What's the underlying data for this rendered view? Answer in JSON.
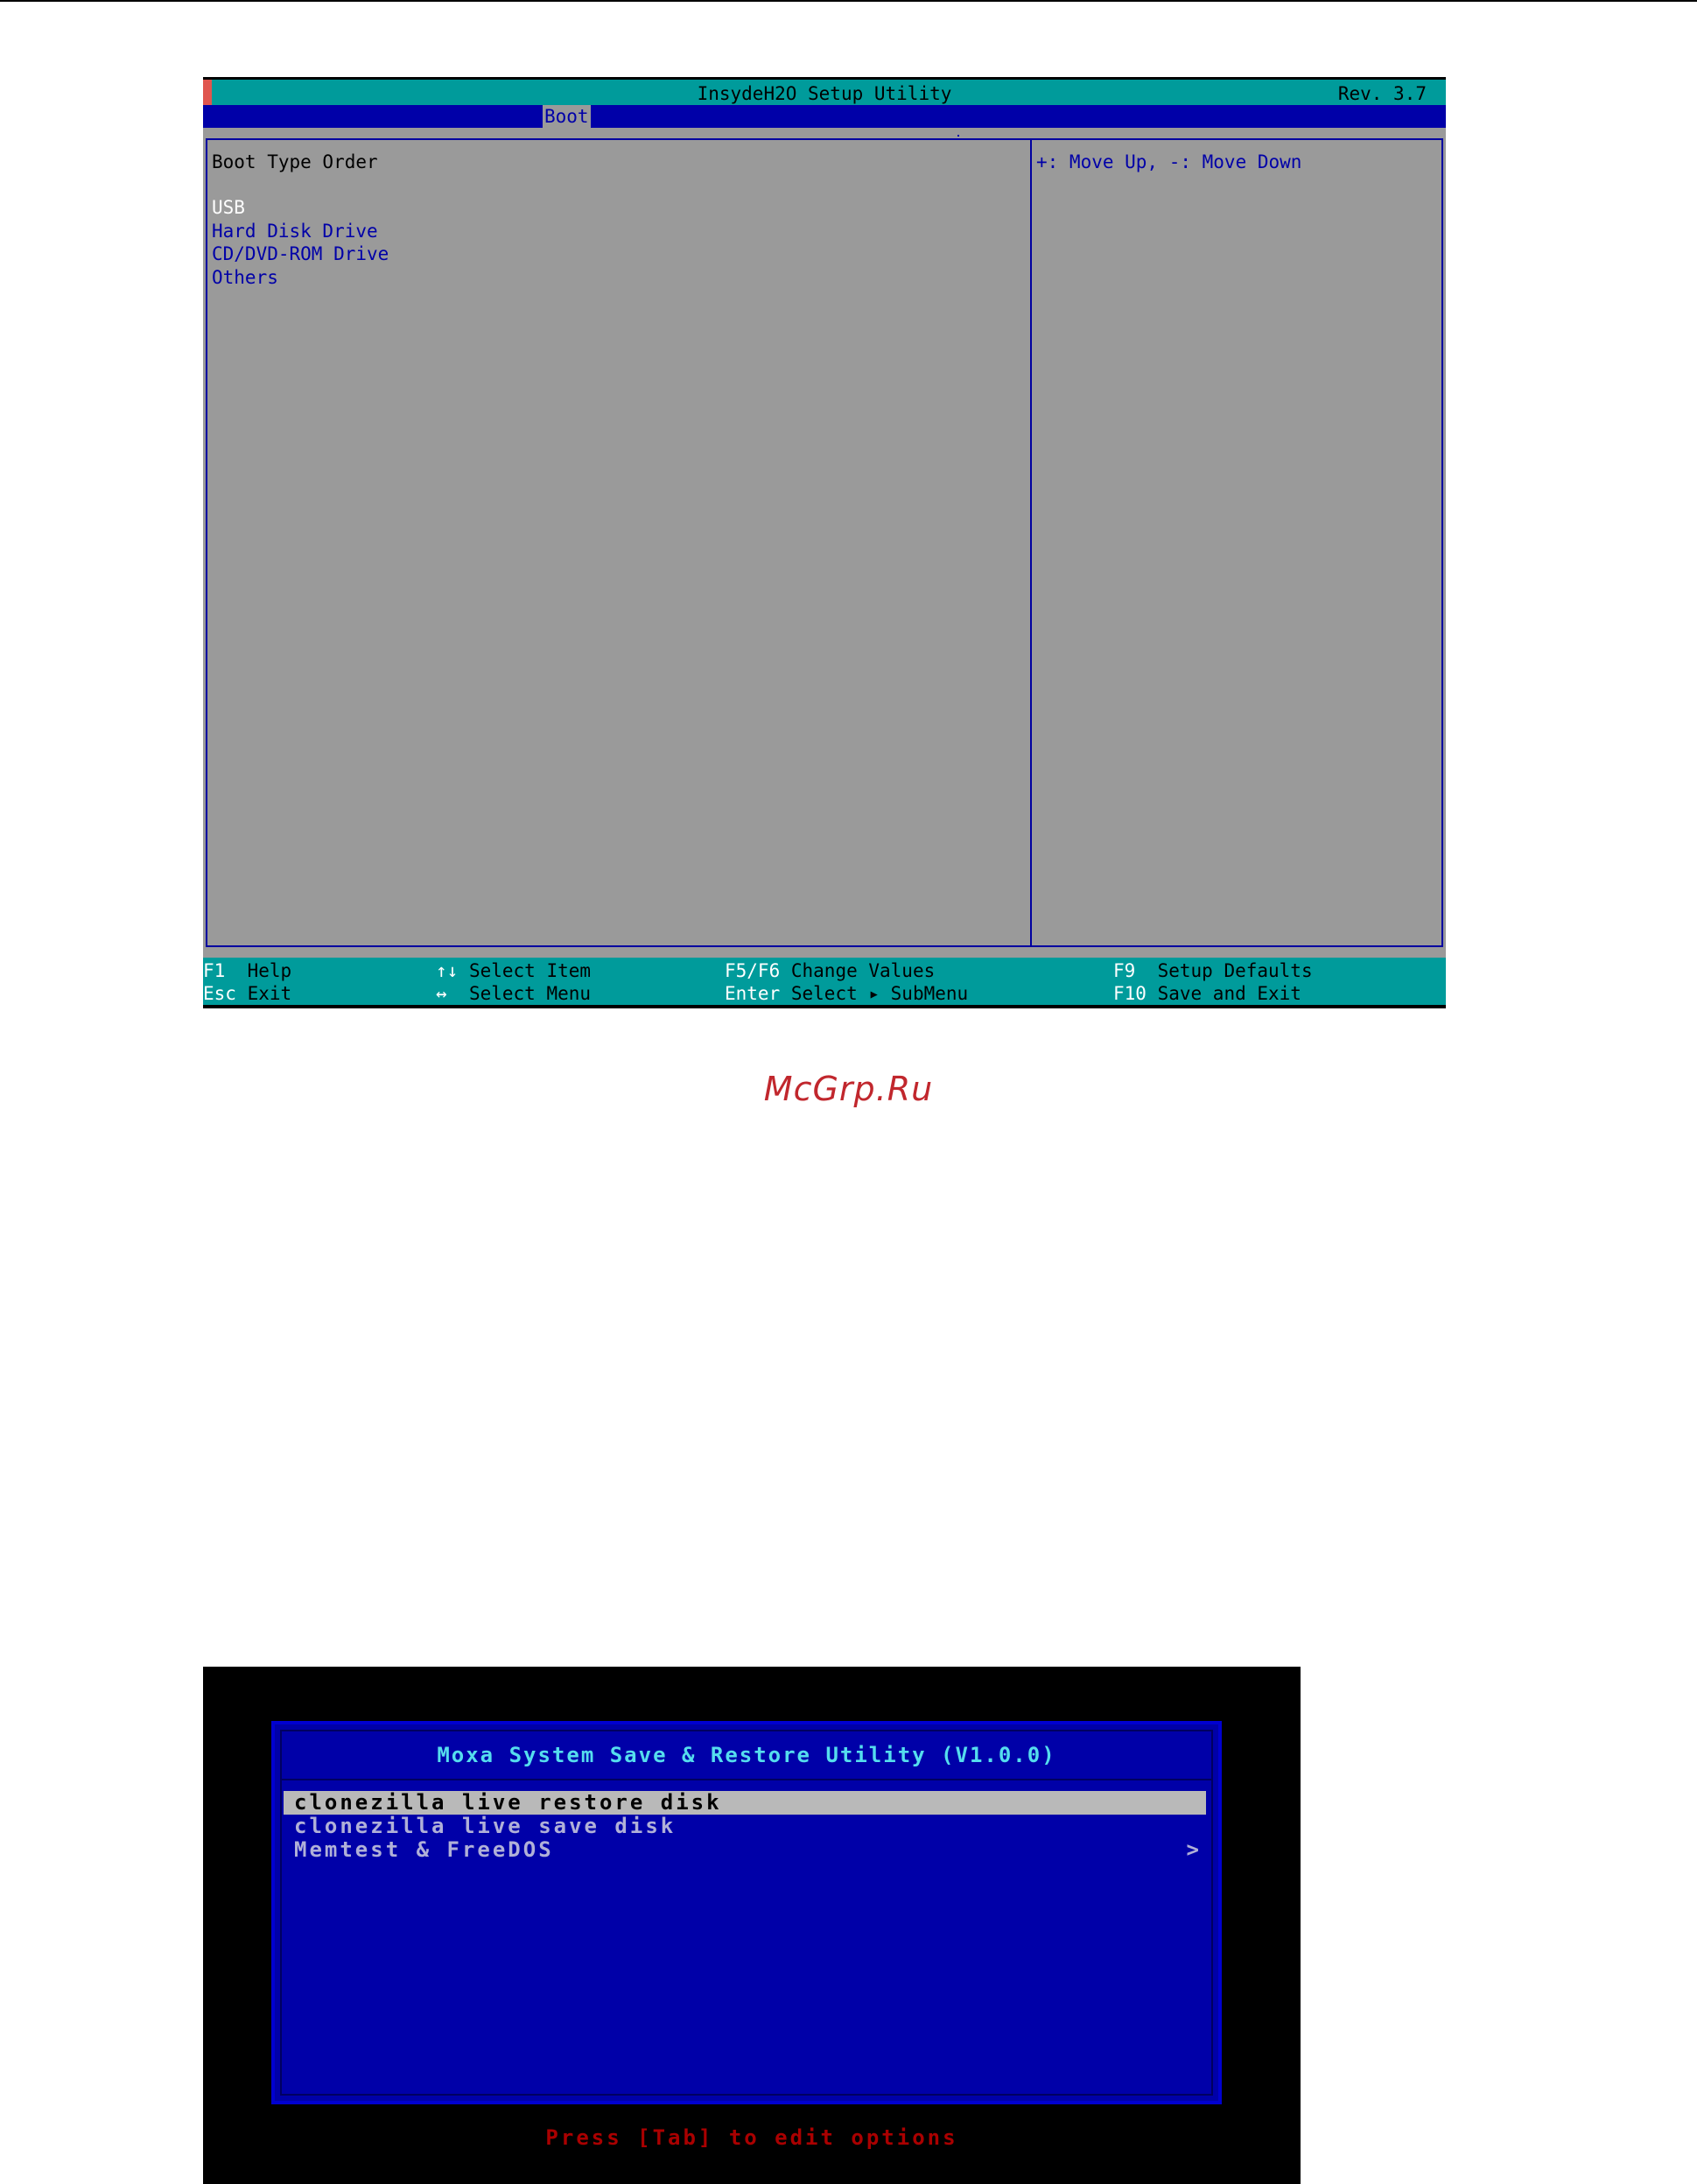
{
  "bios": {
    "title": "InsydeH2O Setup Utility",
    "revision": "Rev. 3.7",
    "active_tab": "Boot",
    "section_title": "Boot Type Order",
    "boot_order": [
      "USB",
      "Hard Disk Drive",
      "CD/DVD-ROM Drive",
      "Others"
    ],
    "selected_index": 0,
    "help_text": "+: Move Up, -: Move Down",
    "hotkeys": {
      "help": {
        "key": "F1",
        "label": "Help"
      },
      "exit": {
        "key": "Esc",
        "label": "Exit"
      },
      "select_item": {
        "key": "↑↓",
        "label": "Select Item"
      },
      "select_menu": {
        "key": "↔",
        "label": "Select Menu"
      },
      "change_values": {
        "key": "F5/F6",
        "label": "Change Values"
      },
      "select_submenu": {
        "key": "Enter",
        "label": "Select ▸ SubMenu"
      },
      "setup_defaults": {
        "key": "F9",
        "label": "Setup Defaults"
      },
      "save_exit": {
        "key": "F10",
        "label": "Save and Exit"
      }
    },
    "colors": {
      "background": "#9a9a9a",
      "bar": "#009b9b",
      "accent": "#0000a8"
    }
  },
  "watermark": "McGrp.Ru",
  "moxa": {
    "title": "Moxa System Save & Restore Utility (V1.0.0)",
    "menu_items": [
      {
        "label": "clonezilla live restore disk",
        "has_submenu": false
      },
      {
        "label": "clonezilla live save disk",
        "has_submenu": false
      },
      {
        "label": "Memtest & FreeDOS",
        "has_submenu": true,
        "arrow": ">"
      }
    ],
    "selected_index": 0,
    "hint": "Press [Tab] to edit options",
    "colors": {
      "panel": "#0000a8",
      "title": "#55ddee",
      "hint": "#aa0000"
    }
  }
}
